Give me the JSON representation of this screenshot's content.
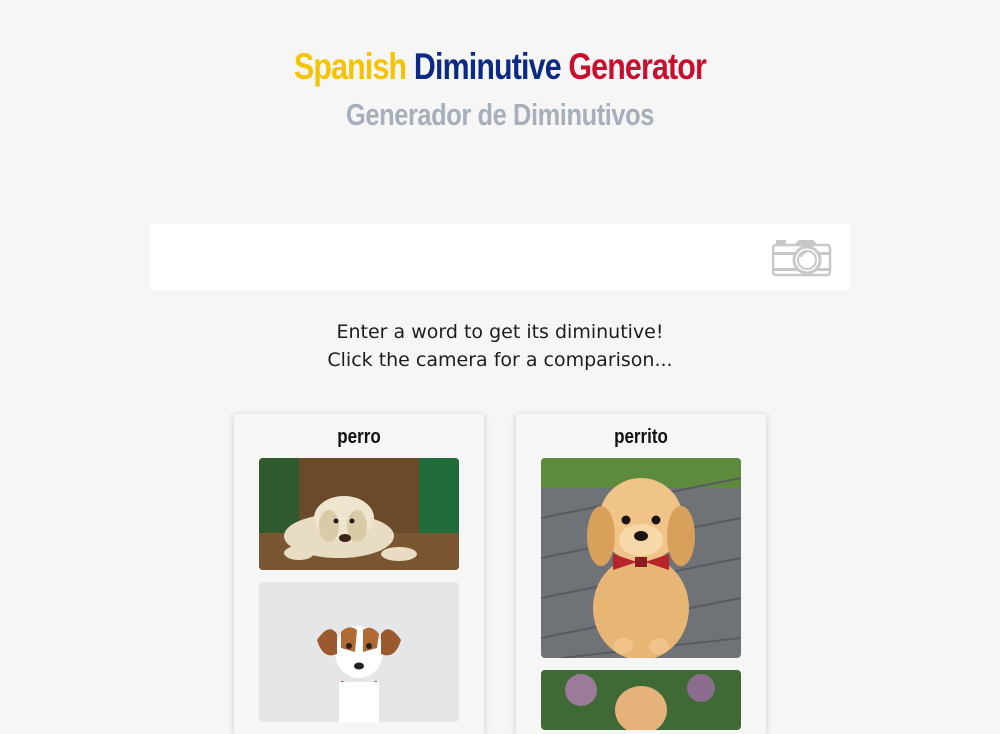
{
  "header": {
    "title_word1": "Spanish",
    "title_word2": "Diminutive",
    "title_word3": "Generator",
    "subtitle": "Generador de Diminutivos"
  },
  "search": {
    "value": "",
    "placeholder": ""
  },
  "camera_icon": "camera-icon",
  "instructions": {
    "line1": "Enter a word to get its diminutive!",
    "line2": "Click the camera for a comparison..."
  },
  "cards": [
    {
      "word": "perro"
    },
    {
      "word": "perrito"
    }
  ],
  "colors": {
    "spanish_yellow": "#f5c400",
    "diminutive_blue": "#0b2a85",
    "generator_red": "#c8102e",
    "subtitle_gray": "#a6afba",
    "background": "#f6f6f6"
  }
}
